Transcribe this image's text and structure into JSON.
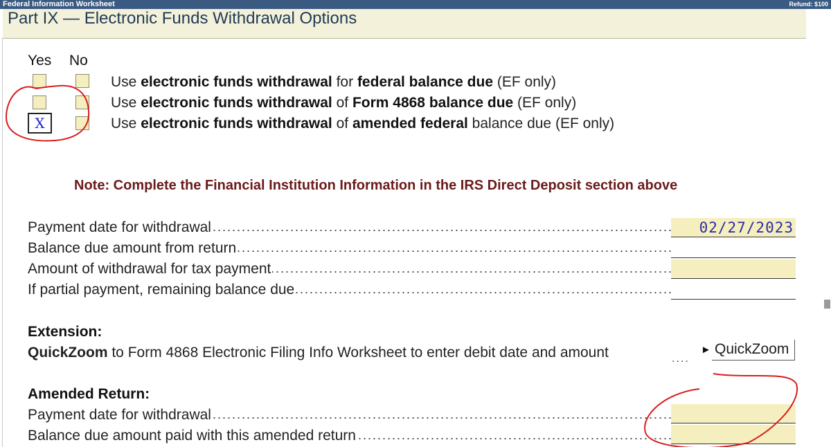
{
  "window": {
    "title": "Federal Information Worksheet",
    "refund": "Refund: $100"
  },
  "part": {
    "title": "Part IX — Electronic Funds Withdrawal Options"
  },
  "columns": {
    "yes": "Yes",
    "no": "No"
  },
  "options": [
    {
      "yes_checked": false,
      "no_checked": false,
      "parts": [
        {
          "text": "Use ",
          "bold": false
        },
        {
          "text": "electronic funds withdrawal",
          "bold": true
        },
        {
          "text": " for ",
          "bold": false
        },
        {
          "text": "federal balance due",
          "bold": true
        },
        {
          "text": " (EF only)",
          "bold": false
        }
      ]
    },
    {
      "yes_checked": false,
      "no_checked": false,
      "parts": [
        {
          "text": "Use ",
          "bold": false
        },
        {
          "text": "electronic funds withdrawal",
          "bold": true
        },
        {
          "text": " of ",
          "bold": false
        },
        {
          "text": "Form 4868 balance due",
          "bold": true
        },
        {
          "text": " (EF only)",
          "bold": false
        }
      ]
    },
    {
      "yes_checked": true,
      "no_checked": false,
      "check_mark": "X",
      "parts": [
        {
          "text": "Use ",
          "bold": false
        },
        {
          "text": "electronic funds withdrawal",
          "bold": true
        },
        {
          "text": " of ",
          "bold": false
        },
        {
          "text": "amended federal",
          "bold": true
        },
        {
          "text": " balance due (EF only)",
          "bold": false
        }
      ]
    }
  ],
  "note": "Note: Complete the Financial Institution Information in the IRS Direct Deposit section above",
  "fields": [
    {
      "label": "Payment date for withdrawal",
      "value": "02/27/2023",
      "yellow": true
    },
    {
      "label": "Balance due amount from return",
      "value": "",
      "yellow": false
    },
    {
      "label": "Amount of withdrawal for tax payment",
      "value": "",
      "yellow": true
    },
    {
      "label": "If partial payment, remaining balance due",
      "value": "",
      "yellow": false
    }
  ],
  "extension": {
    "heading": "Extension:",
    "quickzoom_bold": "QuickZoom",
    "quickzoom_text": " to Form 4868 Electronic Filing Info Worksheet to enter debit date and amount",
    "dots": "....",
    "arrow": "►",
    "button_label": "QuickZoom"
  },
  "amended": {
    "heading": "Amended Return:",
    "fields": [
      {
        "label": "Payment date for withdrawal",
        "value": "",
        "yellow": true
      },
      {
        "label": "Balance due amount paid with this amended return",
        "value": "",
        "yellow": true
      }
    ]
  },
  "colors": {
    "title_bar": "#3a5a82",
    "header_bg": "#f3f1da",
    "input_bg": "#f5efbf",
    "note_color": "#6b1a1a",
    "value_color": "#2a2aa8",
    "annotation_red": "#d81c1c"
  },
  "icons": [
    "checkbox-icon",
    "triangle-right-icon"
  ]
}
